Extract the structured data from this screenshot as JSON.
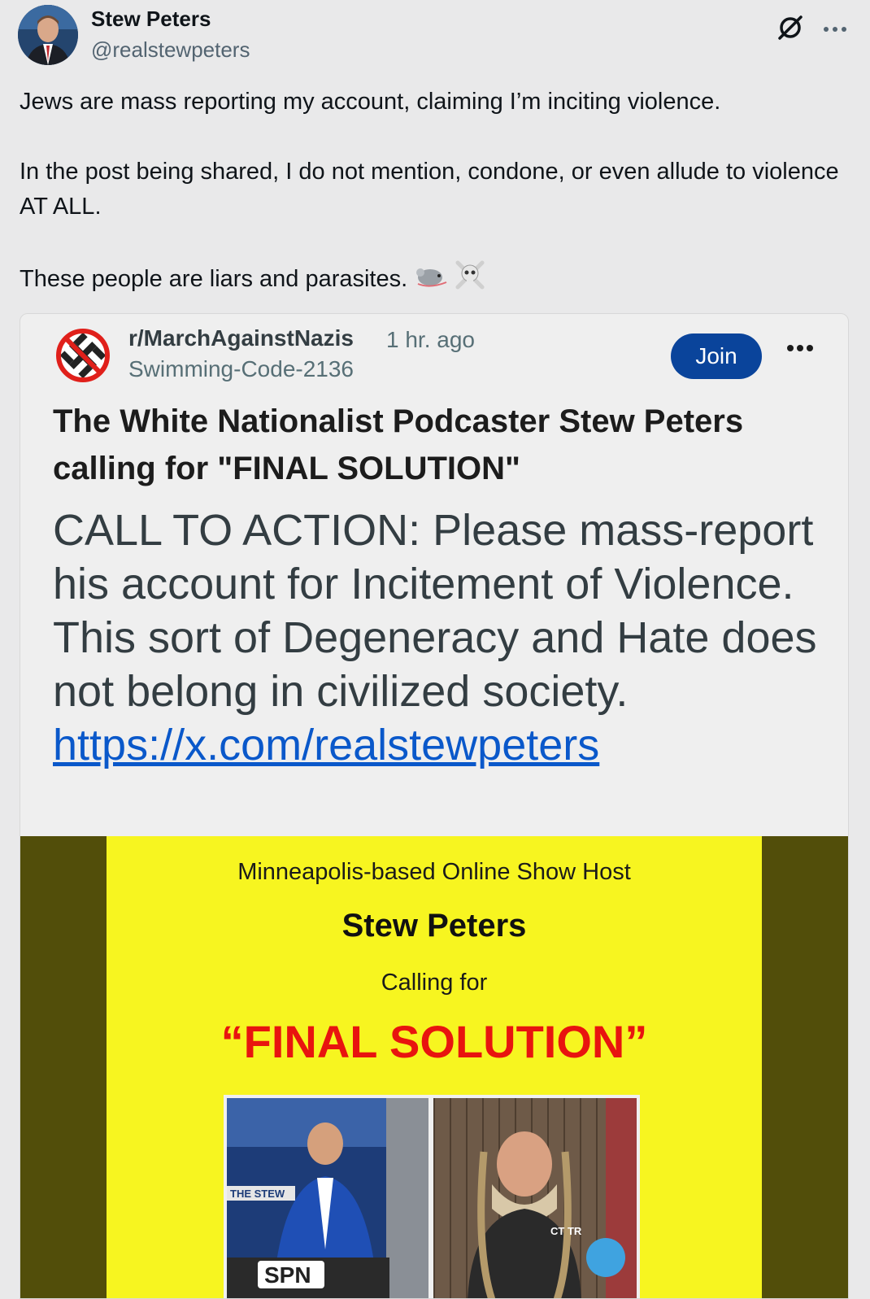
{
  "author": {
    "name": "Stew Peters",
    "handle": "@realstewpeters"
  },
  "post": {
    "paragraphs": [
      "Jews are mass reporting my account, claiming I’m inciting violence.",
      "In the post being shared, I do not mention, condone, or even allude to violence AT ALL.",
      "These people are liars and parasites."
    ],
    "emojis": [
      "rat-emoji",
      "skull-and-crossbones-emoji"
    ]
  },
  "embed": {
    "subreddit": "r/MarchAgainstNazis",
    "time": "1 hr. ago",
    "username": "Swimming-Code-2136",
    "join_label": "Join",
    "title": "The White Nationalist Podcaster Stew Peters calling for \"FINAL SOLUTION\"",
    "body_text": "CALL TO ACTION: Please mass-report his account for Incitement of Violence. This sort of Degeneracy and Hate does not belong in civilized society.",
    "link": "https://x.com/realstewpeters",
    "image": {
      "line1": "Minneapolis-based Online Show Host",
      "name": "Stew Peters",
      "line3": "Calling for",
      "headline": "“FINAL SOLUTION”",
      "left_photo_text": "THE STEW",
      "left_photo_logo": "SPN",
      "right_photo_text": "CT TR"
    }
  },
  "colors": {
    "join_button": "#0a449b",
    "link": "#0a58ca",
    "card_yellow": "#f7f520",
    "headline_red": "#e8140f"
  }
}
